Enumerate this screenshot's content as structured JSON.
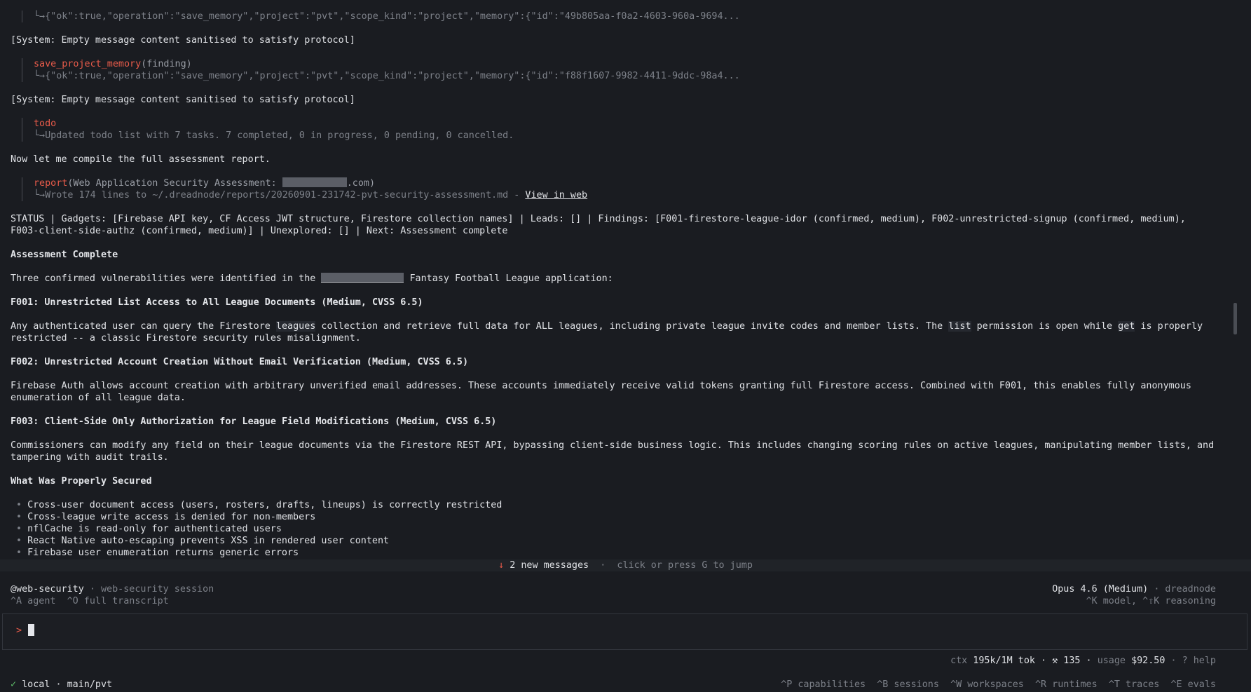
{
  "transcript": {
    "line1_result": "└→{\"ok\":true,\"operation\":\"save_memory\",\"project\":\"pvt\",\"scope_kind\":\"project\",\"memory\":{\"id\":\"49b805aa-f0a2-4603-960a-9694...",
    "system_msg_1": "[System: Empty message content sanitised to satisfy protocol]",
    "tool2_name": "save_project_memory",
    "tool2_args": "(finding)",
    "tool2_result": "└→{\"ok\":true,\"operation\":\"save_memory\",\"project\":\"pvt\",\"scope_kind\":\"project\",\"memory\":{\"id\":\"f88f1607-9982-4411-9ddc-98a4...",
    "system_msg_2": "[System: Empty message content sanitised to satisfy protocol]",
    "tool3_name": "todo",
    "tool3_result": "└→Updated todo list with 7 tasks. 7 completed, 0 in progress, 0 pending, 0 cancelled.",
    "compile_msg": "Now let me compile the full assessment report.",
    "tool4_name": "report",
    "tool4_args_prefix": "(Web Application Security Assessment: ",
    "tool4_args_suffix": ".com)",
    "tool4_result": "└→Wrote 174 lines to ~/.dreadnode/reports/20260901-231742-pvt-security-assessment.md - ",
    "tool4_link": "View in web",
    "status_line1": "STATUS | Gadgets: [Firebase API key, CF Access JWT structure, Firestore collection names] | Leads: [] | Findings: [F001-firestore-league-idor (confirmed, medium), F002-unrestricted-signup (confirmed, medium),",
    "status_line2": "F003-client-side-authz (confirmed, medium)] | Unexplored: [] | Next: Assessment complete",
    "heading_complete": "Assessment Complete",
    "intro_prefix": "Three confirmed vulnerabilities were identified in the ",
    "intro_suffix": " Fantasy Football League application:",
    "f001_title": "F001: Unrestricted List Access to All League Documents (Medium, CVSS 6.5)",
    "f001_p1a": "Any authenticated user can query the Firestore ",
    "f001_code1": "leagues",
    "f001_p1b": " collection and retrieve full data for ALL leagues, including private league invite codes and member lists. The ",
    "f001_code2": "list",
    "f001_p1c": " permission is open while ",
    "f001_code3": "get",
    "f001_p1d": " is properly",
    "f001_p2": "restricted -- a classic Firestore security rules misalignment.",
    "f002_title": "F002: Unrestricted Account Creation Without Email Verification (Medium, CVSS 6.5)",
    "f002_p1": "Firebase Auth allows account creation with arbitrary unverified email addresses. These accounts immediately receive valid tokens granting full Firestore access. Combined with F001, this enables fully anonymous",
    "f002_p2": "enumeration of all league data.",
    "f003_title": "F003: Client-Side Only Authorization for League Field Modifications (Medium, CVSS 6.5)",
    "f003_p1": "Commissioners can modify any field on their league documents via the Firestore REST API, bypassing client-side business logic. This includes changing scoring rules on active leagues, manipulating member lists, and",
    "f003_p2": "tampering with audit trails.",
    "secured_heading": "What Was Properly Secured",
    "bullet_char": "•",
    "secured": [
      "Cross-user document access (users, rosters, drafts, lineups) is correctly restricted",
      "Cross-league write access is denied for non-members",
      "nflCache is read-only for authenticated users",
      "React Native auto-escaping prevents XSS in rendered user content",
      "Firebase user enumeration returns generic errors"
    ]
  },
  "new_messages": {
    "arrow": "↓",
    "label": "2 new messages",
    "separator": "·",
    "hint": "click or press G to jump"
  },
  "status": {
    "agent": "@web-security",
    "session": "· web-security session",
    "shortcuts_left": "^A agent  ^O full transcript",
    "model": "Opus 4.6 (Medium)",
    "provider": "· dreadnode",
    "shortcuts_right": "^K model, ^⇧K reasoning"
  },
  "input": {
    "prompt": ">"
  },
  "usage": {
    "ctx_label": "ctx",
    "ctx_value": "195k/1M tok",
    "tools": "· ⚒ 135 ·",
    "usage_label": "usage",
    "usage_value": "$92.50",
    "help": "· ? help"
  },
  "bottom": {
    "check": "✓",
    "location": "local",
    "branch": "· main/pvt",
    "menu": [
      "^P capabilities",
      "^B sessions",
      "^W workspaces",
      "^R runtimes",
      "^T traces",
      "^E evals"
    ]
  },
  "colors": {
    "background": "#1a1c21",
    "accent": "#e85b4a",
    "ok": "#5fbf6a"
  }
}
